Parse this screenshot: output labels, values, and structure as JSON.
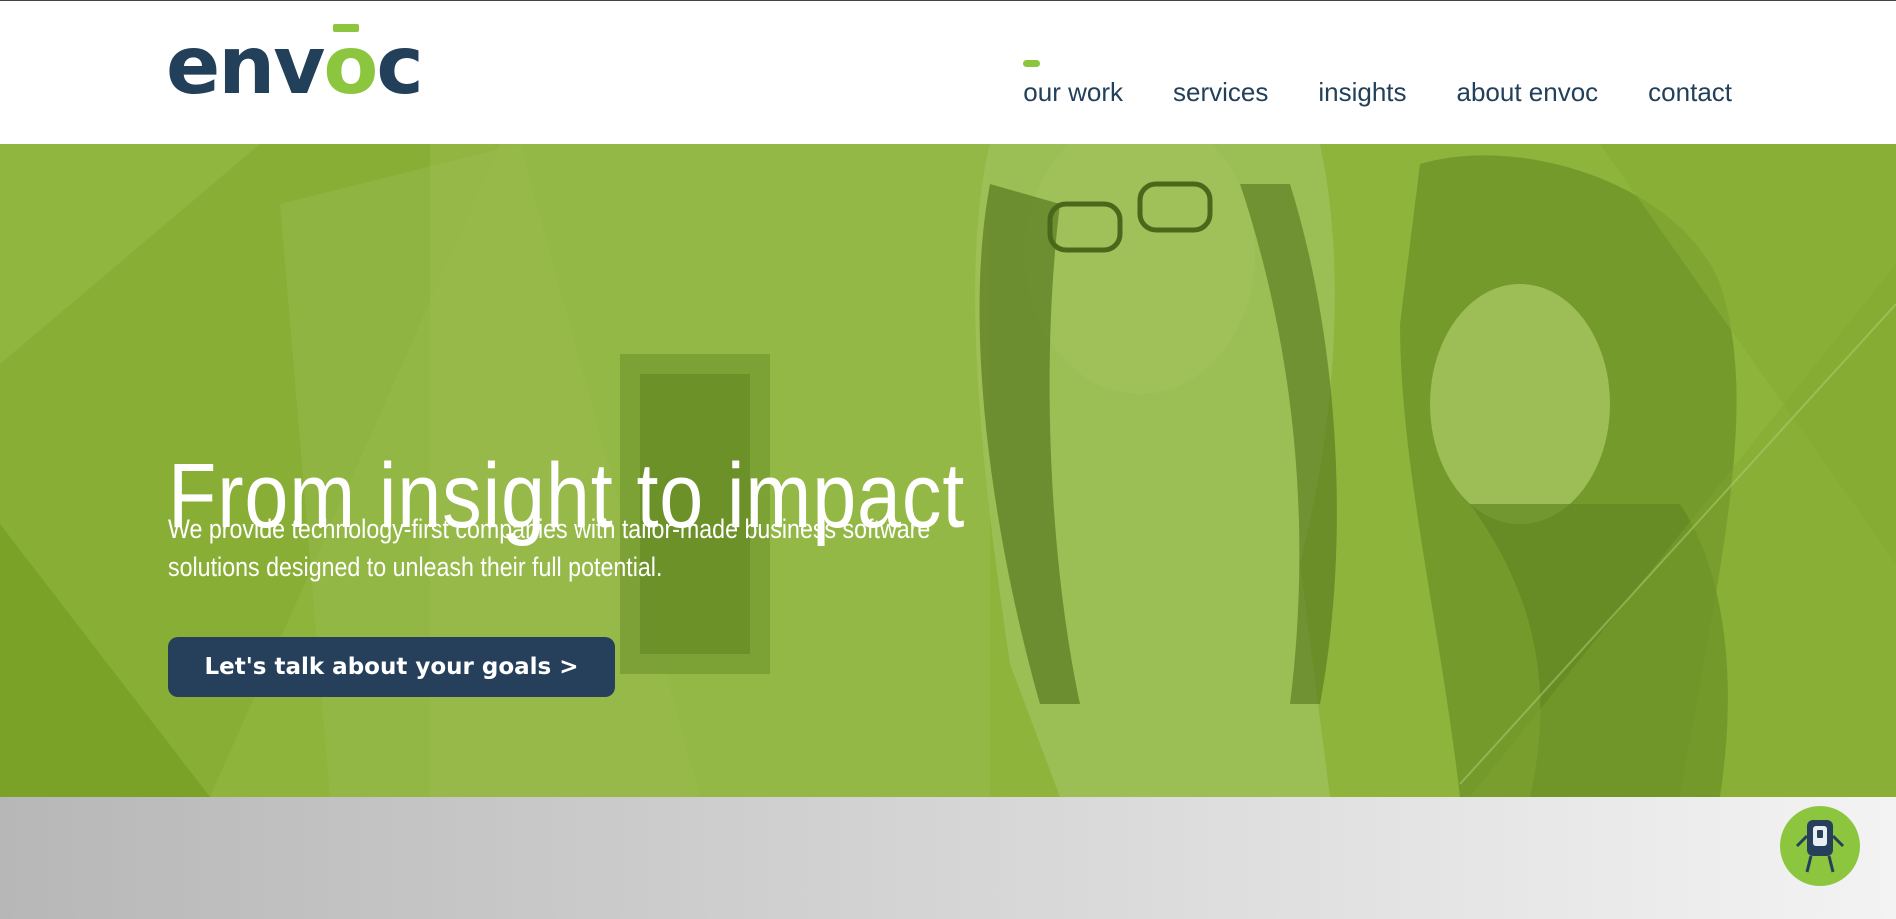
{
  "brand": {
    "logo_text_pre": "env",
    "logo_text_accent": "o",
    "logo_text_post": "c",
    "primary_color": "#23405a",
    "accent_color": "#8cc63f"
  },
  "nav": {
    "items": [
      {
        "label": "our work",
        "active": true
      },
      {
        "label": "services",
        "active": false
      },
      {
        "label": "insights",
        "active": false
      },
      {
        "label": "about envoc",
        "active": false
      },
      {
        "label": "contact",
        "active": false
      }
    ]
  },
  "hero": {
    "title": "From insight to impact",
    "subtitle_line1": "We provide technology-first companies with tailor-made business software",
    "subtitle_line2": "solutions designed to unleash their full potential.",
    "cta_label": "Let's talk about your goals >",
    "overlay_color": "#8cb13a"
  },
  "widgets": {
    "chatbot_icon": "robot-chat-icon"
  }
}
